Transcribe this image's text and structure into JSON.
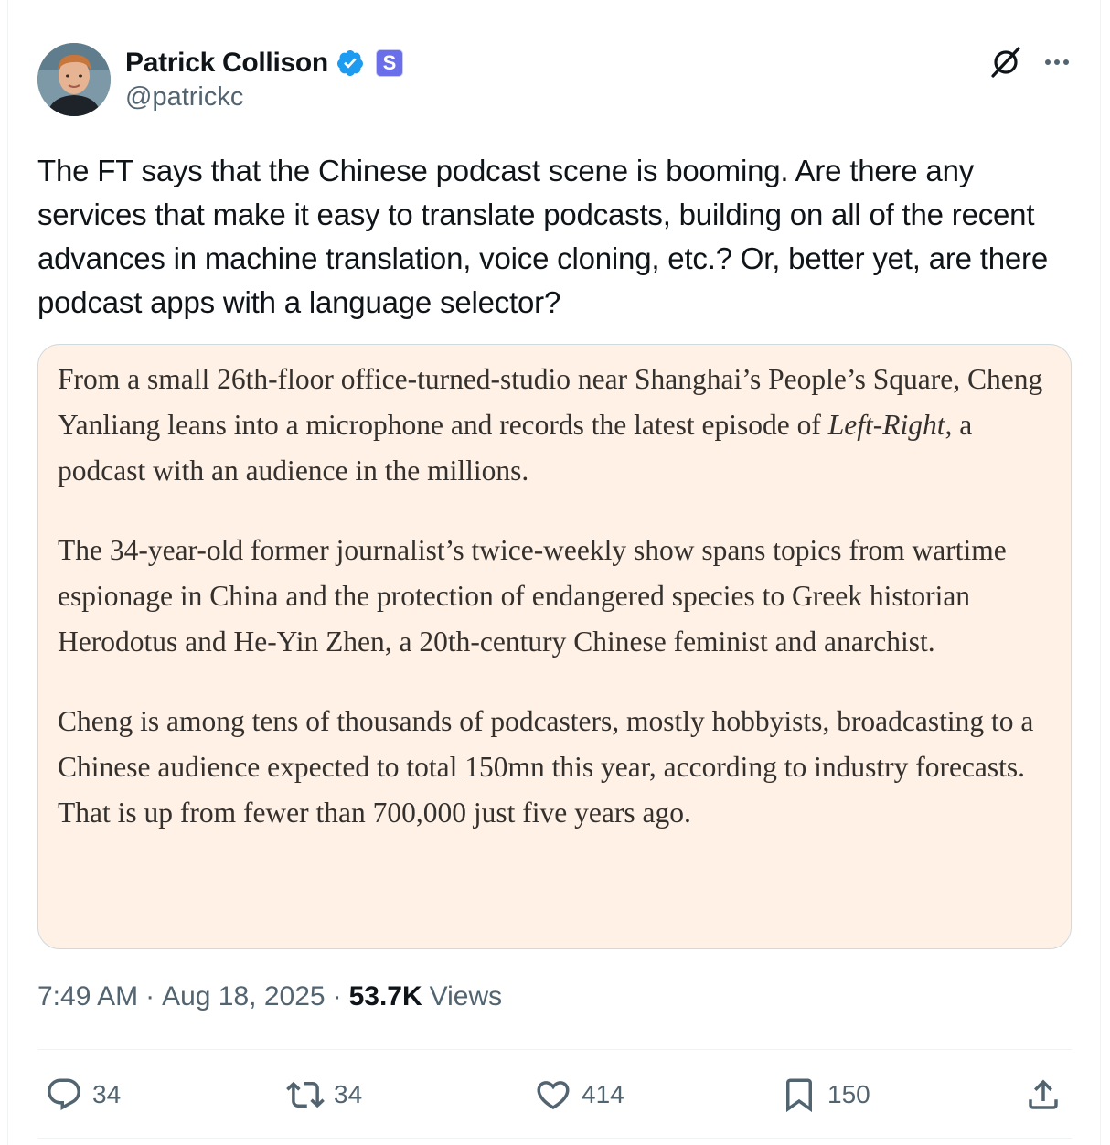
{
  "author": {
    "name": "Patrick Collison",
    "handle": "@patrickc",
    "badge_letter": "S",
    "verified_color": "#1d9bf0",
    "badge_color": "#6a6ee8"
  },
  "tweet": {
    "text": "The FT says that the Chinese podcast scene is booming. Are there any services that make it easy to translate podcasts, building on all of the recent advances in machine translation, voice cloning, etc.? Or, better yet, are there podcast apps with a language selector?"
  },
  "quote": {
    "p1_a": "From a small 26th-floor office-turned-studio near Shanghai’s People’s Square, Cheng Yanliang leans into a microphone and records the latest episode of ",
    "p1_italic": "Left-Right",
    "p1_b": ", a podcast with an audience in the millions.",
    "p2": "The 34-year-old former journalist’s twice-weekly show spans topics from wartime espionage in China and the protection of endangered species to Greek historian Herodotus and He-Yin Zhen, a 20th-century Chinese feminist and anarchist.",
    "p3": "Cheng is among tens of thousands of podcasters, mostly hobbyists, broadcasting to a Chinese audience expected to total 150mn this year, according to industry forecasts. That is up from fewer than 700,000 just five years ago.",
    "background_color": "#fff1e5"
  },
  "meta": {
    "time": "7:49 AM",
    "date": "Aug 18, 2025",
    "views_count": "53.7K",
    "views_label": "Views"
  },
  "actions": {
    "replies": "34",
    "reposts": "34",
    "likes": "414",
    "bookmarks": "150"
  },
  "icons": [
    "verified-icon",
    "grok-icon",
    "more-icon",
    "reply-icon",
    "repost-icon",
    "like-icon",
    "bookmark-icon",
    "share-icon"
  ]
}
